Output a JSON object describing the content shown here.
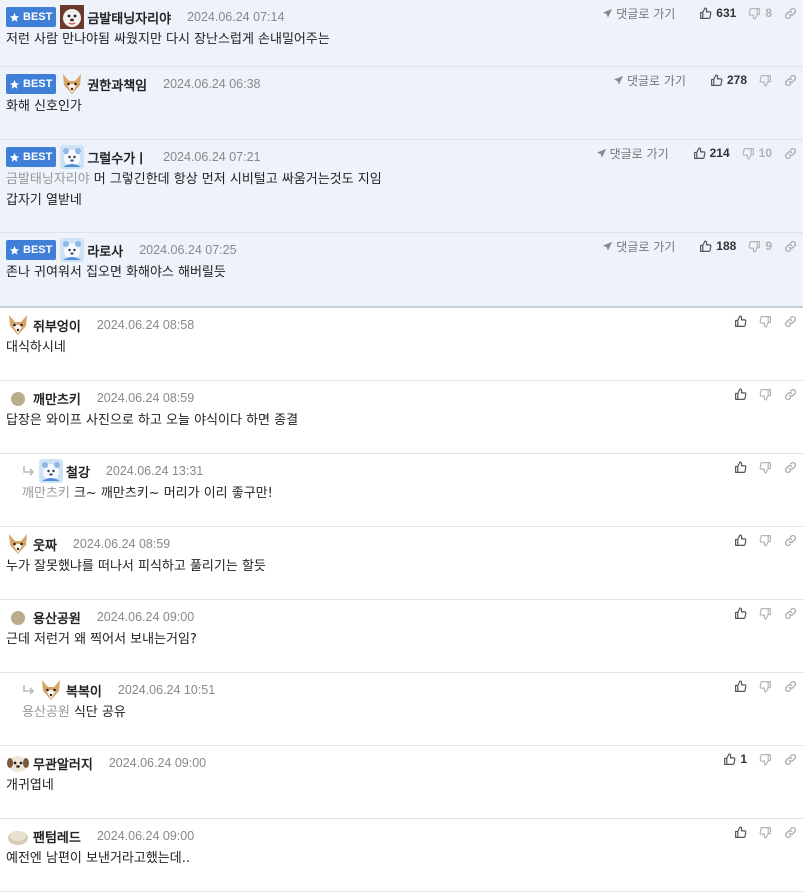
{
  "labels": {
    "best": "BEST",
    "goto": "댓글로 가기"
  },
  "colors": {
    "best_bg": "#eef3fb",
    "badge": "#3f7fd8"
  },
  "comments": [
    {
      "best": true,
      "nick": "금발태닝자리야",
      "date": "2024.06.24 07:14",
      "lines": [
        "저런 사람 만나야됨 싸웠지만 다시 장난스럽게 손내밀어주는"
      ],
      "up": "631",
      "down": "8",
      "avatar": "white-dog-icon"
    },
    {
      "best": true,
      "nick": "권한과책임",
      "date": "2024.06.24 06:38",
      "lines": [
        "화해 신호인가"
      ],
      "up": "278",
      "down": "",
      "avatar": "fox-dog-icon"
    },
    {
      "best": true,
      "nick": "그럴수가ㅣ",
      "date": "2024.06.24 07:21",
      "quote": "금발태닝자리야",
      "lines": [
        "머 그렇긴한데 항상 먼저 시비털고 싸움거는것도 지임",
        "갑자기 열받네"
      ],
      "up": "214",
      "down": "10",
      "avatar": "blue-bear-icon"
    },
    {
      "best": true,
      "nick": "라로사",
      "date": "2024.06.24 07:25",
      "lines": [
        "존나 귀여워서 집오면 화해야스 해버릴듯"
      ],
      "up": "188",
      "down": "9",
      "avatar": "blue-bear-icon"
    },
    {
      "best": false,
      "nick": "쥐부엉이",
      "date": "2024.06.24 08:58",
      "lines": [
        "대식하시네"
      ],
      "up": "",
      "down": "",
      "avatar": "fox-dog-icon"
    },
    {
      "best": false,
      "nick": "깨만츠키",
      "date": "2024.06.24 08:59",
      "lines": [
        "답장은 와이프 사진으로 하고 오늘 야식이다 하면 종결"
      ],
      "up": "",
      "down": "",
      "avatar": "dot-avatar-icon"
    },
    {
      "best": false,
      "reply": true,
      "nick": "철강",
      "date": "2024.06.24 13:31",
      "quote": "깨만츠키",
      "lines": [
        "크~ 깨만츠키~ 머리가 이리 좋구만!"
      ],
      "up": "",
      "down": "",
      "avatar": "blue-bear-icon"
    },
    {
      "best": false,
      "nick": "웃짜",
      "date": "2024.06.24 08:59",
      "lines": [
        "누가 잘못했냐를 떠나서 피식하고 풀리기는 할듯"
      ],
      "up": "",
      "down": "",
      "avatar": "fox-dog-icon"
    },
    {
      "best": false,
      "nick": "용산공원",
      "date": "2024.06.24 09:00",
      "lines": [
        "근데 저런거 왜 찍어서 보내는거임?"
      ],
      "up": "",
      "down": "",
      "avatar": "dot-avatar-icon"
    },
    {
      "best": false,
      "reply": true,
      "nick": "복복이",
      "date": "2024.06.24 10:51",
      "quote": "용산공원",
      "lines": [
        "식단 공유"
      ],
      "up": "",
      "down": "",
      "avatar": "fox-dog-icon"
    },
    {
      "best": false,
      "nick": "무관알러지",
      "date": "2024.06.24 09:00",
      "lines": [
        "개귀엽네"
      ],
      "up": "1",
      "down": "",
      "avatar": "puppy-icon"
    },
    {
      "best": false,
      "nick": "팬텀레드",
      "date": "2024.06.24 09:00",
      "lines": [
        "예전엔 남편이 보낸거라고했는데.."
      ],
      "up": "",
      "down": "",
      "avatar": "round-blob-icon"
    }
  ]
}
